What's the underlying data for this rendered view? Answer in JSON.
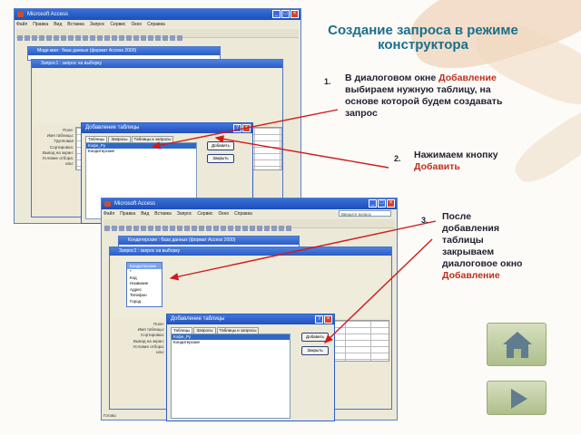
{
  "slide": {
    "title": "Создание запроса в режиме конструктора",
    "steps": [
      {
        "num": "1.",
        "before": "В диалоговом окне ",
        "highlight": "Добавление",
        "after": " выбираем нужную таблицу, на основе которой будем создавать запрос"
      },
      {
        "num": "2.",
        "before": "Нажимаем кнопку ",
        "highlight": "Добавить",
        "after": ""
      },
      {
        "num": "3.",
        "before": "После добавления таблицы закрываем диалоговое окно ",
        "highlight": "Добавление",
        "after": ""
      }
    ]
  },
  "shot1": {
    "app_title": "Microsoft Access",
    "menu": [
      "Файл",
      "Правка",
      "Вид",
      "Вставка",
      "Запрос",
      "Сервис",
      "Окно",
      "Справка"
    ],
    "db_window_title": "Моди мая : база данных (формат Access 2000)",
    "query_window_title": "Запрос1 : запрос на выборку",
    "row_labels": [
      "Поле:",
      "Имя таблицы:",
      "Групповая",
      "Сортировка:",
      "Вывод на экран:",
      "Условие отбора:",
      "или:"
    ],
    "dialog_title": "Добавление таблицы",
    "tabs": [
      "Таблицы",
      "Запросы",
      "Таблицы и запросы"
    ],
    "list_items": [
      "Кофе_Ру",
      "Кондитерские"
    ],
    "btn_add": "Добавить",
    "btn_close": "Закрыть"
  },
  "shot2": {
    "app_title": "Microsoft Access",
    "menu": [
      "Файл",
      "Правка",
      "Вид",
      "Вставка",
      "Запрос",
      "Сервис",
      "Окно",
      "Справка"
    ],
    "search_placeholder": "Введите вопрос",
    "db_window_title": "Кондитерские : база данных (формат Access 2000)",
    "query_window_title": "Запрос1 : запрос на выборку",
    "table_name": "Кондитерские",
    "table_fields": [
      "*",
      "Код",
      "Название",
      "Адрес",
      "Телефон",
      "Город"
    ],
    "row_labels": [
      "Поле:",
      "Имя таблицы:",
      "Сортировка:",
      "Вывод на экран:",
      "Условие отбора:",
      "или:"
    ],
    "dialog_title": "Добавление таблицы",
    "tabs": [
      "Таблицы",
      "Запросы",
      "Таблицы и запросы"
    ],
    "list_items": [
      "Кофе_Ру",
      "Кондитерские"
    ],
    "btn_add": "Добавить",
    "btn_close": "Закрыть",
    "status": "Готово"
  },
  "nav": {
    "home_icon": "home-icon",
    "next_icon": "play-arrow-icon"
  },
  "colors": {
    "accent": "#c0301e",
    "title": "#1a6f8a",
    "xp_blue": "#2150bd"
  }
}
